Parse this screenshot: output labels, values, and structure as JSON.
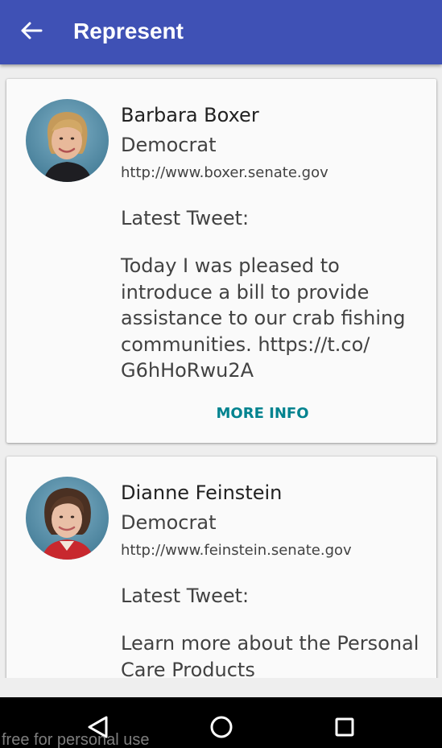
{
  "appbar": {
    "title": "Represent",
    "back_icon": "arrow-back-icon",
    "color": "#3f51b5"
  },
  "representatives": [
    {
      "name": "Barbara Boxer",
      "party": "Democrat",
      "website": "http://www.boxer.senate.gov",
      "tweet_label": "Latest Tweet:",
      "tweet": "Today I was pleased to introduce a bill to provide assistance to our crab fishing communities. https://t.co/ G6hHoRwu2A",
      "more_info_label": "MORE INFO",
      "photo": "portrait-photo"
    },
    {
      "name": "Dianne Feinstein",
      "party": "Democrat",
      "website": "http://www.feinstein.senate.gov",
      "tweet_label": "Latest Tweet:",
      "tweet": "Learn more about the Personal Care Products",
      "photo": "portrait-photo"
    }
  ],
  "accent_color": "#00838f",
  "navbar": {
    "back_icon": "nav-back-triangle-icon",
    "home_icon": "nav-home-circle-icon",
    "recents_icon": "nav-recents-square-icon"
  },
  "watermark": "free for personal use"
}
